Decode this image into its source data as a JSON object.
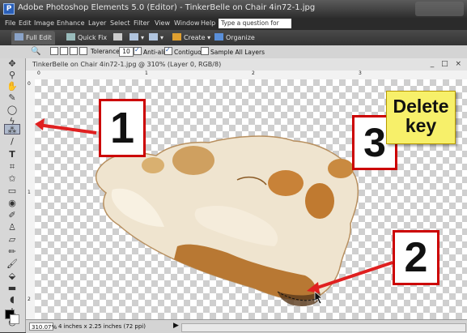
{
  "window": {
    "title": "Adobe Photoshop Elements 5.0 (Editor) - TinkerBelle on Chair 4in72-1.jpg"
  },
  "menu": {
    "items": [
      "File",
      "Edit",
      "Image",
      "Enhance",
      "Layer",
      "Select",
      "Filter",
      "View",
      "Window",
      "Help"
    ],
    "help_placeholder": "Type a question for help"
  },
  "modes": {
    "full_edit": "Full Edit",
    "quick_fix": "Quick Fix",
    "create": "Create",
    "organize": "Organize"
  },
  "options": {
    "tolerance_label": "Tolerance:",
    "tolerance_value": "10",
    "anti_alias": "Anti-alias",
    "contiguous": "Contiguous",
    "sample_all_layers": "Sample All Layers"
  },
  "document": {
    "title": "TinkerBelle on Chair 4in72-1.jpg @ 310% (Layer 0, RGB/8)",
    "window_controls": "_ □ ×",
    "ruler_top_labels": [
      "0",
      "1",
      "2",
      "3"
    ],
    "ruler_left_labels": [
      "0",
      "1",
      "2"
    ],
    "zoom": "310.07%",
    "dimensions": "4 inches x 2.25 inches (72 ppi)"
  },
  "annotations": {
    "callout_1": "1",
    "callout_2": "2",
    "callout_3": "3",
    "note": "Delete key"
  },
  "colors": {
    "callout_border": "#cc0000",
    "arrow": "#e02020",
    "note_bg": "#f7f06a"
  },
  "tools": [
    "move-icon",
    "zoom-icon",
    "hand-icon",
    "eyedropper-icon",
    "marquee-icon",
    "lasso-icon",
    "magic-wand-icon",
    "selection-brush-icon",
    "type-icon",
    "crop-icon",
    "cookie-cutter-icon",
    "straighten-icon",
    "red-eye-icon",
    "healing-brush-icon",
    "clone-stamp-icon",
    "eraser-icon",
    "pencil-icon",
    "brush-icon",
    "paint-bucket-icon",
    "gradient-icon",
    "shape-icon",
    "blur-icon",
    "sponge-icon"
  ]
}
